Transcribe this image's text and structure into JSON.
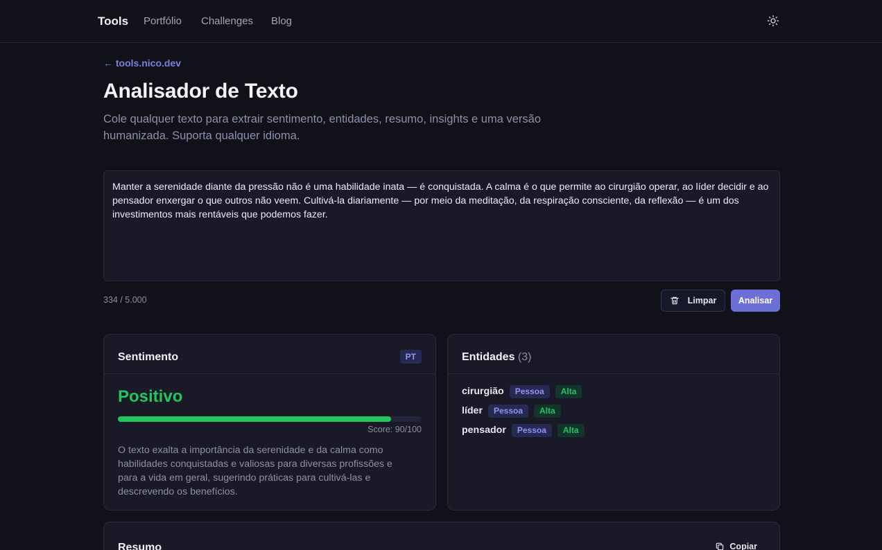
{
  "nav": {
    "brand": "Tools",
    "links": [
      "Portfólio",
      "Challenges",
      "Blog"
    ],
    "theme_icon": "sun-icon"
  },
  "back_link": "← tools.nico.dev",
  "page": {
    "title": "Analisador de Texto",
    "description": "Cole qualquer texto para extrair sentimento, entidades, resumo, insights e uma versão humanizada. Suporta qualquer idioma."
  },
  "input": {
    "text": "Manter a serenidade diante da pressão não é uma habilidade inata — é conquistada. A calma é o que permite ao cirurgião operar, ao líder decidir e ao pensador enxergar o que outros não veem. Cultivá-la diariamente — por meio da meditação, da respiração consciente, da reflexão — é um dos investimentos mais rentáveis que podemos fazer.",
    "char_count": "334 / 5.000"
  },
  "actions": {
    "clear_label": "Limpar",
    "clear_icon": "trash-icon",
    "analyze_label": "Analisar"
  },
  "sentiment": {
    "title": "Sentimento",
    "language_badge": "PT",
    "label": "Positivo",
    "score": 90,
    "score_text": "Score: 90/100",
    "summary": "O texto exalta a importância da serenidade e da calma como habilidades conquistadas e valiosas para diversas profissões e para a vida em geral, sugerindo práticas para cultivá-las e descrevendo os benefícios.",
    "color": "#22c55e"
  },
  "entities": {
    "title": "Entidades",
    "count": "(3)",
    "items": [
      {
        "name": "cirurgião",
        "type": "Pessoa",
        "confidence": "Alta"
      },
      {
        "name": "líder",
        "type": "Pessoa",
        "confidence": "Alta"
      },
      {
        "name": "pensador",
        "type": "Pessoa",
        "confidence": "Alta"
      }
    ]
  },
  "summary_card": {
    "title": "Resumo",
    "copy_label": "Copiar",
    "copy_icon": "copy-icon"
  },
  "colors": {
    "accent": "#6b6fd6",
    "background": "#111119",
    "card": "#191927",
    "positive": "#22c55e"
  }
}
